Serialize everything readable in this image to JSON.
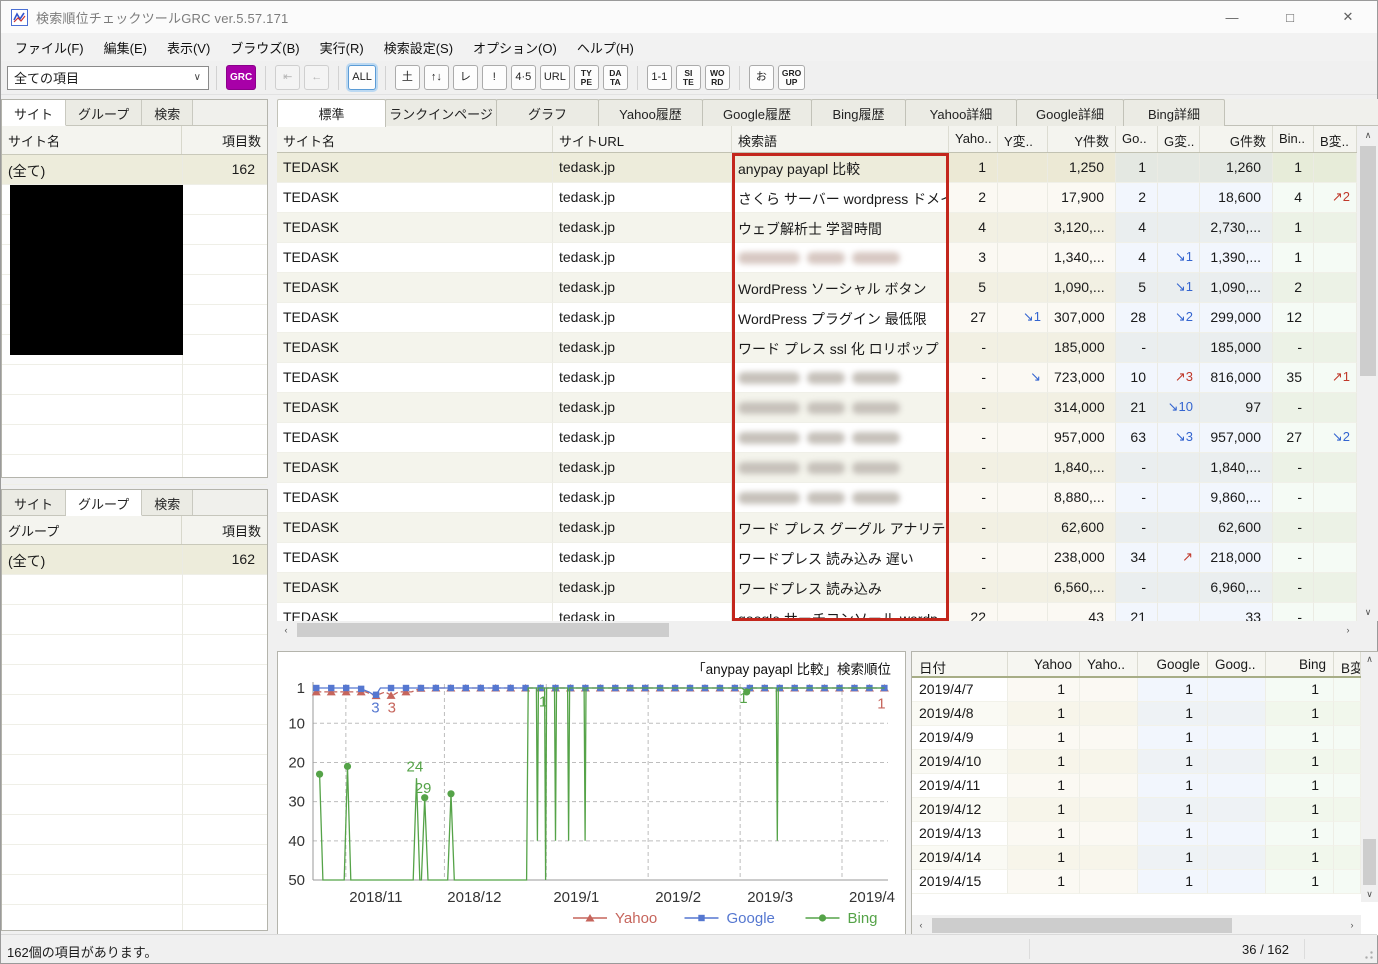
{
  "window": {
    "title": "検索順位チェックツールGRC  ver.5.57.171",
    "controls": {
      "minimize": "—",
      "maximize": "□",
      "close": "✕"
    }
  },
  "menu": {
    "items": [
      "ファイル(F)",
      "編集(E)",
      "表示(V)",
      "ブラウズ(B)",
      "実行(R)",
      "検索設定(S)",
      "オプション(O)",
      "ヘルプ(H)"
    ]
  },
  "toolbar": {
    "filter": {
      "value": "全ての項目"
    },
    "groups": [
      [
        {
          "label": "GRC",
          "style": "grc"
        }
      ],
      [
        {
          "label": "⇤",
          "disabled": true
        },
        {
          "label": "←",
          "disabled": true
        }
      ],
      [
        {
          "label": "ALL",
          "active": true
        }
      ],
      [
        {
          "label": "土"
        },
        {
          "label": "↑↓"
        },
        {
          "label": "レ"
        },
        {
          "label": "!"
        },
        {
          "label": "4·5"
        },
        {
          "label": "URL"
        },
        {
          "label": "TY\nPE",
          "two": true
        },
        {
          "label": "DA\nTA",
          "two": true
        }
      ],
      [
        {
          "label": "1-1"
        },
        {
          "label": "SI\nTE",
          "two": true
        },
        {
          "label": "WO\nRD",
          "two": true
        }
      ],
      [
        {
          "label": "お"
        },
        {
          "label": "GRO\nUP",
          "two": true
        }
      ]
    ]
  },
  "left_top": {
    "tabs": [
      "サイト",
      "グループ",
      "検索"
    ],
    "active_tab": "サイト",
    "columns": [
      "サイト名",
      "項目数"
    ],
    "rows": [
      {
        "name": "(全て)",
        "count": "162",
        "selected": true
      }
    ],
    "redacted": true
  },
  "left_bottom": {
    "tabs": [
      "サイト",
      "グループ",
      "検索"
    ],
    "active_tab": "グループ",
    "columns": [
      "グループ",
      "項目数"
    ],
    "rows": [
      {
        "name": "(全て)",
        "count": "162",
        "selected": true
      }
    ]
  },
  "main_table": {
    "tabs": [
      "標準",
      "ランクインページ",
      "グラフ",
      "Yahoo履歴",
      "Google履歴",
      "Bing履歴",
      "Yahoo詳細",
      "Google詳細",
      "Bing詳細"
    ],
    "active_tab": "標準",
    "columns": [
      "サイト名",
      "サイトURL",
      "検索語",
      "Yaho..",
      "Y変..",
      "Y件数",
      "Go..",
      "G変..",
      "G件数",
      "Bin..",
      "B変.."
    ],
    "rows": [
      {
        "site": "TEDASK",
        "url": "tedask.jp",
        "term": "anypay payapl 比較",
        "y": "1",
        "yc": "",
        "yn": "1,250",
        "g": "1",
        "gc": "",
        "gn": "1,260",
        "b": "1",
        "bc": "",
        "selected": true
      },
      {
        "site": "TEDASK",
        "url": "tedask.jp",
        "term": "さくら サーバー wordpress ドメイ..",
        "y": "2",
        "yc": "",
        "yn": "17,900",
        "g": "2",
        "gc": "",
        "gn": "18,600",
        "b": "4",
        "bc": {
          "text": "↗2",
          "dir": "up"
        }
      },
      {
        "site": "TEDASK",
        "url": "tedask.jp",
        "term": "ウェブ解析士 学習時間",
        "y": "4",
        "yc": "",
        "yn": "3,120,...",
        "g": "4",
        "gc": "",
        "gn": "2,730,...",
        "b": "1",
        "bc": ""
      },
      {
        "site": "TEDASK",
        "url": "tedask.jp",
        "term": "",
        "blurred": true,
        "pink": true,
        "y": "3",
        "yc": "",
        "yn": "1,340,...",
        "g": "4",
        "gc": {
          "text": "↘1",
          "dir": "down"
        },
        "gn": "1,390,...",
        "b": "1",
        "bc": ""
      },
      {
        "site": "TEDASK",
        "url": "tedask.jp",
        "term": "WordPress ソーシャル ボタン",
        "y": "5",
        "yc": "",
        "yn": "1,090,...",
        "g": "5",
        "gc": {
          "text": "↘1",
          "dir": "down"
        },
        "gn": "1,090,...",
        "b": "2",
        "bc": ""
      },
      {
        "site": "TEDASK",
        "url": "tedask.jp",
        "term": "WordPress プラグイン 最低限",
        "y": "27",
        "yc": {
          "text": "↘1",
          "dir": "down"
        },
        "yn": "307,000",
        "g": "28",
        "gc": {
          "text": "↘2",
          "dir": "down"
        },
        "gn": "299,000",
        "b": "12",
        "bc": ""
      },
      {
        "site": "TEDASK",
        "url": "tedask.jp",
        "term": "ワード プレス ssl 化 ロリポップ",
        "y": "-",
        "yc": "",
        "yn": "185,000",
        "g": "-",
        "gc": "",
        "gn": "185,000",
        "b": "-",
        "bc": ""
      },
      {
        "site": "TEDASK",
        "url": "tedask.jp",
        "term": "",
        "blurred": true,
        "y": "-",
        "yc": {
          "text": "↘",
          "dir": "down"
        },
        "yn": "723,000",
        "g": "10",
        "gc": {
          "text": "↗3",
          "dir": "up"
        },
        "gn": "816,000",
        "b": "35",
        "bc": {
          "text": "↗1",
          "dir": "up"
        }
      },
      {
        "site": "TEDASK",
        "url": "tedask.jp",
        "term": "",
        "blurred": true,
        "y": "-",
        "yc": "",
        "yn": "314,000",
        "g": "21",
        "gc": {
          "text": "↘10",
          "dir": "down"
        },
        "gn": "97",
        "b": "-",
        "bc": ""
      },
      {
        "site": "TEDASK",
        "url": "tedask.jp",
        "term": "",
        "blurred": true,
        "y": "-",
        "yc": "",
        "yn": "957,000",
        "g": "63",
        "gc": {
          "text": "↘3",
          "dir": "down"
        },
        "gn": "957,000",
        "b": "27",
        "bc": {
          "text": "↘2",
          "dir": "down"
        }
      },
      {
        "site": "TEDASK",
        "url": "tedask.jp",
        "term": "",
        "blurred": true,
        "y": "-",
        "yc": "",
        "yn": "1,840,...",
        "g": "-",
        "gc": "",
        "gn": "1,840,...",
        "b": "-",
        "bc": ""
      },
      {
        "site": "TEDASK",
        "url": "tedask.jp",
        "term": "",
        "blurred": true,
        "y": "-",
        "yc": "",
        "yn": "8,880,...",
        "g": "-",
        "gc": "",
        "gn": "9,860,...",
        "b": "-",
        "bc": ""
      },
      {
        "site": "TEDASK",
        "url": "tedask.jp",
        "term": "ワード プレス グーグル アナリティク..",
        "y": "-",
        "yc": "",
        "yn": "62,600",
        "g": "-",
        "gc": "",
        "gn": "62,600",
        "b": "-",
        "bc": ""
      },
      {
        "site": "TEDASK",
        "url": "tedask.jp",
        "term": "ワードプレス 読み込み 遅い",
        "y": "-",
        "yc": "",
        "yn": "238,000",
        "g": "34",
        "gc": {
          "text": "↗",
          "dir": "up"
        },
        "gn": "218,000",
        "b": "-",
        "bc": ""
      },
      {
        "site": "TEDASK",
        "url": "tedask.jp",
        "term": "ワードプレス 読み込み",
        "y": "-",
        "yc": "",
        "yn": "6,560,...",
        "g": "-",
        "gc": "",
        "gn": "6,960,...",
        "b": "-",
        "bc": ""
      },
      {
        "site": "TEDASK",
        "url": "tedask.jp",
        "term": "google サーチコンソール wordp..",
        "y": "22",
        "yc": "",
        "yn": "43",
        "g": "21",
        "gc": "",
        "gn": "33",
        "b": "-",
        "bc": ""
      }
    ]
  },
  "chart_data": {
    "type": "line",
    "title": "「anypay payapl 比較」検索順位",
    "y_ticks": [
      1,
      10,
      20,
      30,
      40,
      50
    ],
    "y_inverted": true,
    "ylim": [
      1,
      50
    ],
    "x_ticks": [
      "2018/11",
      "2018/12",
      "2019/1",
      "2019/2",
      "2019/3",
      "2019/4"
    ],
    "x_tick_days": [
      10,
      40,
      71,
      102,
      130,
      161
    ],
    "x_range_days": [
      0,
      175
    ],
    "legend_position": "bottom-right",
    "grid": true,
    "series": [
      {
        "name": "Yahoo",
        "color": "#c6655c",
        "marker": "triangle",
        "dash": true,
        "points": [
          [
            1,
            2
          ],
          [
            13,
            2
          ],
          [
            16,
            2
          ],
          [
            19,
            3
          ],
          [
            22,
            2
          ],
          [
            24,
            3
          ],
          [
            26,
            2
          ],
          [
            30,
            2
          ],
          [
            33,
            1
          ],
          [
            174,
            1
          ]
        ]
      },
      {
        "name": "Google",
        "color": "#5577d0",
        "marker": "square",
        "dash": false,
        "points": [
          [
            1,
            1
          ],
          [
            14,
            1
          ],
          [
            17,
            2
          ],
          [
            19,
            3
          ],
          [
            20.5,
            1
          ],
          [
            174,
            1
          ]
        ]
      },
      {
        "name": "Bing",
        "color": "#55a348",
        "marker": "circle",
        "dash": false,
        "points": [
          [
            2,
            23
          ],
          [
            3,
            50
          ],
          [
            9.5,
            50
          ],
          [
            10.5,
            21
          ],
          [
            11.5,
            50
          ],
          [
            30.5,
            50
          ],
          [
            31.5,
            24
          ],
          [
            32.5,
            50
          ],
          [
            33,
            50
          ],
          [
            34,
            29
          ],
          [
            35,
            50
          ],
          [
            41,
            50
          ],
          [
            42,
            28
          ],
          [
            43,
            50
          ],
          [
            65,
            50
          ],
          [
            65.5,
            1
          ],
          [
            68,
            1
          ],
          [
            68.3,
            40
          ],
          [
            68.6,
            1
          ],
          [
            70.5,
            1
          ],
          [
            70.8,
            50
          ],
          [
            71.1,
            1
          ],
          [
            73.5,
            1
          ],
          [
            73.8,
            40
          ],
          [
            74.1,
            1
          ],
          [
            77.5,
            1
          ],
          [
            77.8,
            40
          ],
          [
            78.1,
            1
          ],
          [
            82.5,
            1
          ],
          [
            82.8,
            40
          ],
          [
            83.1,
            1
          ],
          [
            130.5,
            1
          ],
          [
            132,
            2
          ],
          [
            133.5,
            1
          ],
          [
            141,
            1
          ],
          [
            141.3,
            40
          ],
          [
            141.6,
            1
          ],
          [
            174,
            1
          ]
        ],
        "marker_points": [
          [
            2,
            23
          ],
          [
            10.5,
            21
          ],
          [
            34,
            29
          ],
          [
            42,
            28
          ],
          [
            132,
            2
          ]
        ]
      }
    ],
    "annotations": [
      {
        "text": "3",
        "series": "Google",
        "day": 19,
        "rank": 6
      },
      {
        "text": "3",
        "series": "Yahoo",
        "day": 24,
        "rank": 6
      },
      {
        "text": "24",
        "series": "Bing",
        "day": 31,
        "rank": 21
      },
      {
        "text": "29",
        "series": "Bing",
        "day": 33.5,
        "rank": 26.5
      },
      {
        "text": "1",
        "series": "Bing",
        "day": 70,
        "rank": 4.5
      },
      {
        "text": "1",
        "series": "Bing",
        "day": 131,
        "rank": 3.5
      },
      {
        "text": "1",
        "series": "Yahoo",
        "day": 173,
        "rank": 5
      }
    ]
  },
  "history": {
    "columns": [
      "日付",
      "Yahoo",
      "Yaho..",
      "Google",
      "Goog..",
      "Bing",
      "B変.."
    ],
    "rows": [
      {
        "date": "2019/4/7",
        "yahoo": "1",
        "yc": "",
        "google": "1",
        "gc": "",
        "bing": "1",
        "bc": ""
      },
      {
        "date": "2019/4/8",
        "yahoo": "1",
        "yc": "",
        "google": "1",
        "gc": "",
        "bing": "1",
        "bc": ""
      },
      {
        "date": "2019/4/9",
        "yahoo": "1",
        "yc": "",
        "google": "1",
        "gc": "",
        "bing": "1",
        "bc": ""
      },
      {
        "date": "2019/4/10",
        "yahoo": "1",
        "yc": "",
        "google": "1",
        "gc": "",
        "bing": "1",
        "bc": ""
      },
      {
        "date": "2019/4/11",
        "yahoo": "1",
        "yc": "",
        "google": "1",
        "gc": "",
        "bing": "1",
        "bc": ""
      },
      {
        "date": "2019/4/12",
        "yahoo": "1",
        "yc": "",
        "google": "1",
        "gc": "",
        "bing": "1",
        "bc": ""
      },
      {
        "date": "2019/4/13",
        "yahoo": "1",
        "yc": "",
        "google": "1",
        "gc": "",
        "bing": "1",
        "bc": ""
      },
      {
        "date": "2019/4/14",
        "yahoo": "1",
        "yc": "",
        "google": "1",
        "gc": "",
        "bing": "1",
        "bc": ""
      },
      {
        "date": "2019/4/15",
        "yahoo": "1",
        "yc": "",
        "google": "1",
        "gc": "",
        "bing": "1",
        "bc": ""
      }
    ]
  },
  "statusbar": {
    "left": "162個の項目があります。",
    "position": "36 / 162"
  }
}
